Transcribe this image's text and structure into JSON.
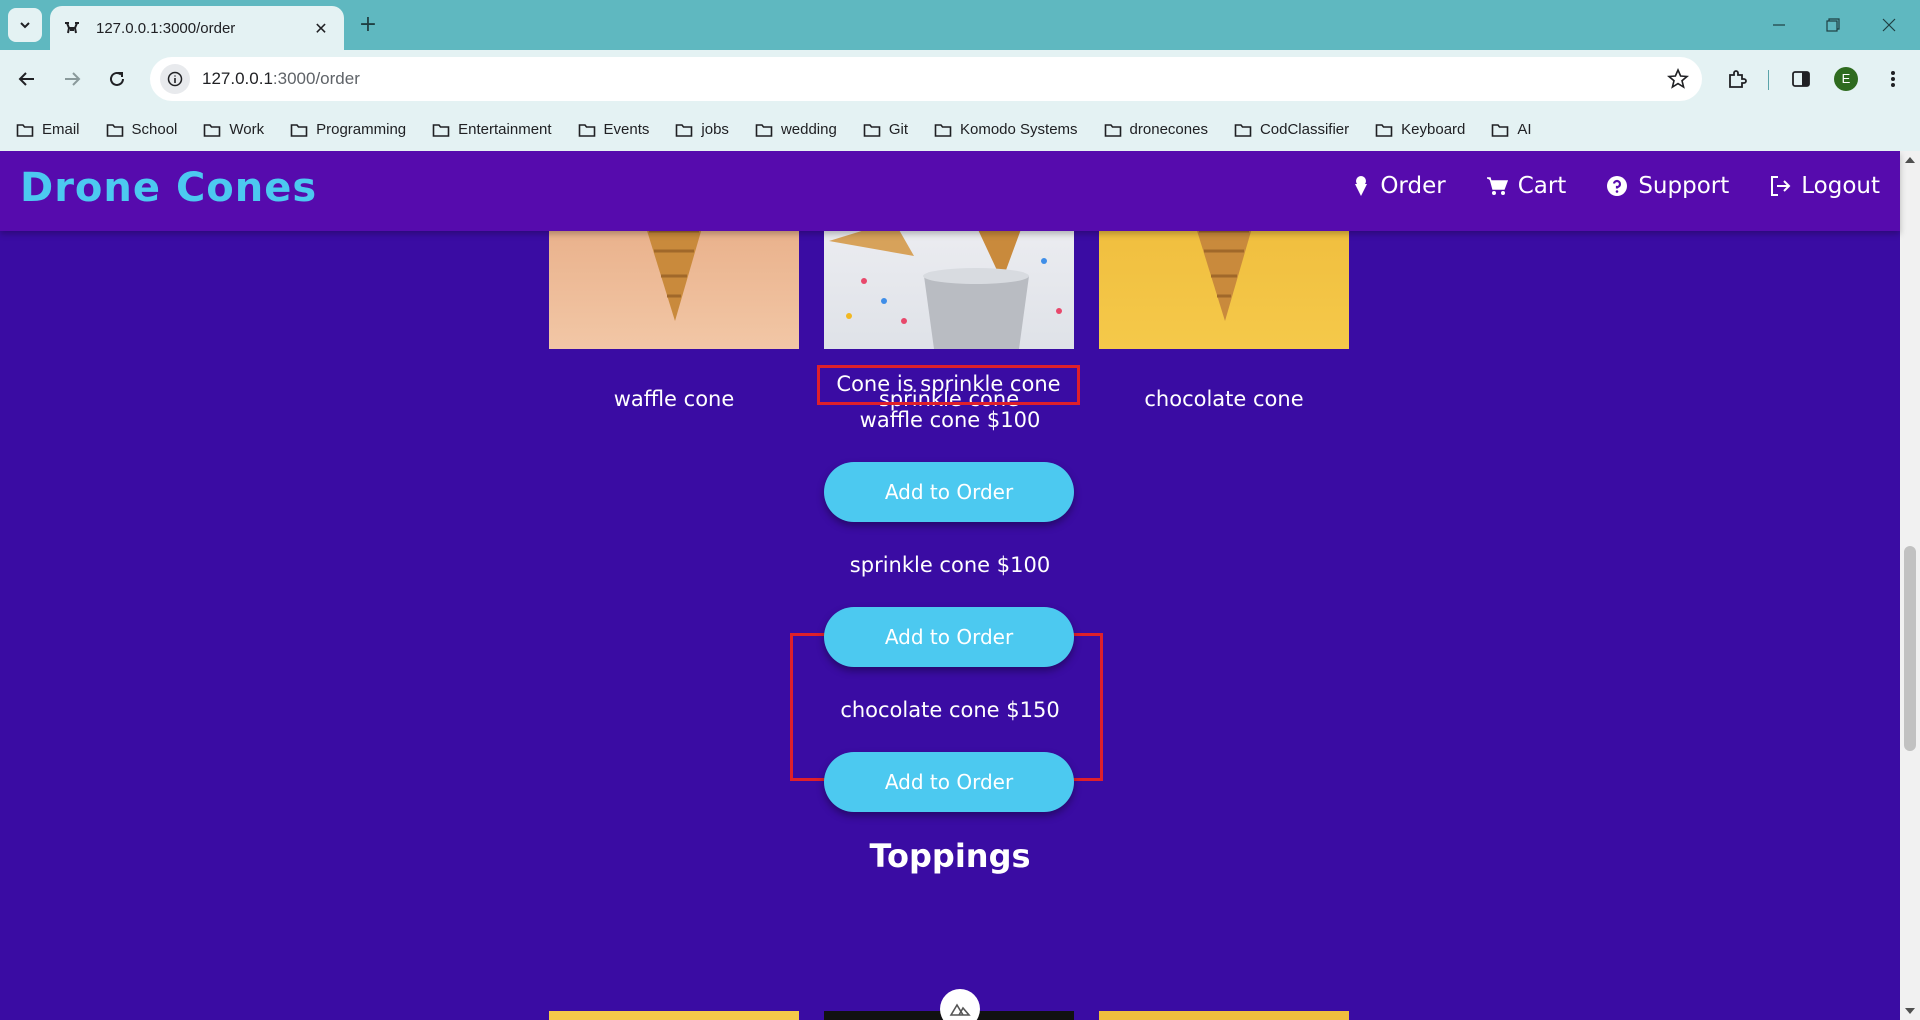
{
  "browser": {
    "tab_title": "127.0.0.1:3000/order",
    "url_host": "127.0.0.1",
    "url_path": ":3000/order",
    "profile_initial": "E",
    "bookmarks": [
      "Email",
      "School",
      "Work",
      "Programming",
      "Entertainment",
      "Events",
      "jobs",
      "wedding",
      "Git",
      "Komodo Systems",
      "dronecones",
      "CodClassifier",
      "Keyboard",
      "AI"
    ]
  },
  "navbar": {
    "brand": "Drone Cones",
    "links": {
      "order": "Order",
      "cart": "Cart",
      "support": "Support",
      "logout": "Logout"
    }
  },
  "cones": {
    "names": [
      "waffle cone",
      "sprinkle cone",
      "chocolate cone"
    ],
    "selected_text": "Cone is sprinkle cone",
    "items": [
      {
        "price_label": "waffle cone $100",
        "button": "Add to Order"
      },
      {
        "price_label": "sprinkle cone $100",
        "button": "Add to Order"
      },
      {
        "price_label": "chocolate cone $150",
        "button": "Add to Order"
      }
    ]
  },
  "toppings": {
    "title": "Toppings"
  },
  "colors": {
    "page_bg": "#3a0ca3",
    "navbar_bg": "#560bad",
    "accent": "#4cc9f0",
    "highlight": "#e0202a"
  }
}
